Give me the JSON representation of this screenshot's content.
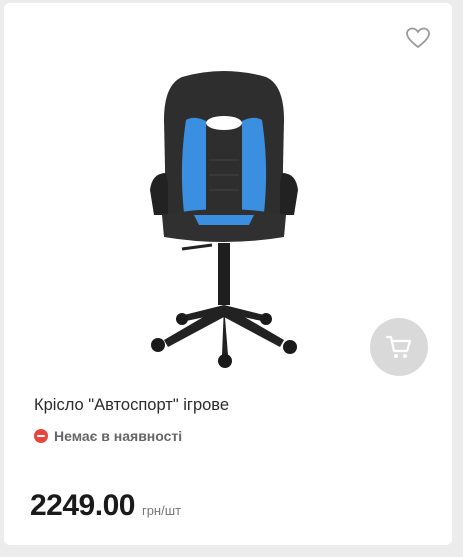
{
  "product": {
    "title": "Крісло \"Автоспорт\" ігрове",
    "availability": "Немає в наявності",
    "price": "2249.00",
    "unit": "грн/шт"
  },
  "colors": {
    "availability_icon": "#e8453c",
    "cart_button_bg": "#d9d9d9",
    "chair_accent": "#3b8fe0"
  },
  "icons": {
    "favorite": "heart-icon",
    "cart": "cart-icon",
    "availability": "minus-circle-icon"
  }
}
